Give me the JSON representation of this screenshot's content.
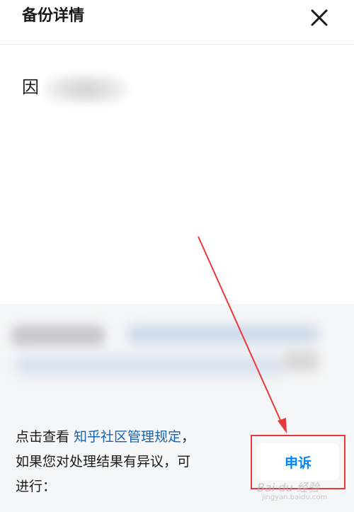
{
  "header": {
    "title": "备份详情",
    "close_icon": "close-icon"
  },
  "content": {
    "reason_char": "因"
  },
  "bottom": {
    "notice_prefix": "点击查看 ",
    "rules_link": "知乎社区管理规定",
    "notice_after_link": "，",
    "notice_line2": "如果您对处理结果有异议，可",
    "notice_line3": "进行：",
    "appeal_label": "申诉"
  },
  "annotation": {
    "color": "#e8393a",
    "watermark": "Bai du 经验",
    "watermark_sub": "jingyan.baidu.com"
  },
  "colors": {
    "link": "#1763b0",
    "appeal_text": "#0084ff",
    "bottom_bg": "#f5f6f7"
  }
}
